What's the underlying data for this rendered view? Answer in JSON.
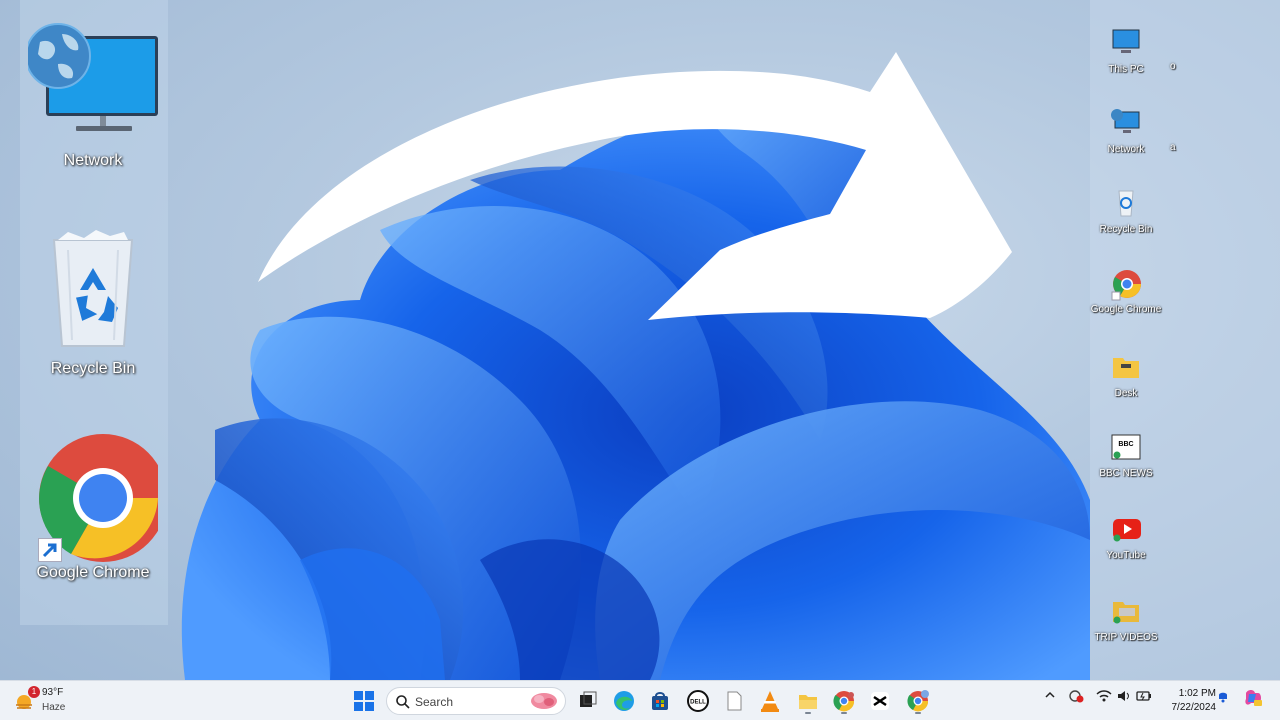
{
  "desktop_left": {
    "network_label": "Network",
    "recycle_label": "Recycle Bin",
    "chrome_label": "Google Chrome"
  },
  "desktop_right": {
    "items": [
      {
        "label": "This PC",
        "extra": "o"
      },
      {
        "label": "Network",
        "extra": "a"
      },
      {
        "label": "Recycle Bin",
        "extra": ""
      },
      {
        "label": "Google Chrome",
        "extra": ""
      },
      {
        "label": "Desk",
        "extra": ""
      },
      {
        "label": "BBC NEWS",
        "extra": ""
      },
      {
        "label": "YouTube",
        "extra": ""
      },
      {
        "label": "TRIP VIDEOS",
        "extra": ""
      }
    ]
  },
  "taskbar": {
    "weather_temp": "93°F",
    "weather_condition": "Haze",
    "weather_badge": "1",
    "search_placeholder": "Search",
    "bbc_text": "BBC",
    "dell_text": "DELL",
    "time": "1:02 PM",
    "date": "7/22/2024"
  },
  "colors": {
    "accent_blue": "#0a5fe0",
    "taskbar_bg": "#eef2f7"
  },
  "icons": [
    "network-icon",
    "recycle-bin-icon",
    "chrome-icon",
    "shortcut-arrow-icon",
    "this-pc-icon",
    "folder-icon",
    "bbc-icon",
    "youtube-icon",
    "windows-start-icon",
    "search-icon",
    "edge-icon",
    "store-icon",
    "dell-icon",
    "file-icon",
    "vlc-icon",
    "file-explorer-icon",
    "capcut-icon",
    "wifi-icon",
    "volume-icon",
    "battery-icon",
    "bell-icon",
    "copilot-icon"
  ]
}
